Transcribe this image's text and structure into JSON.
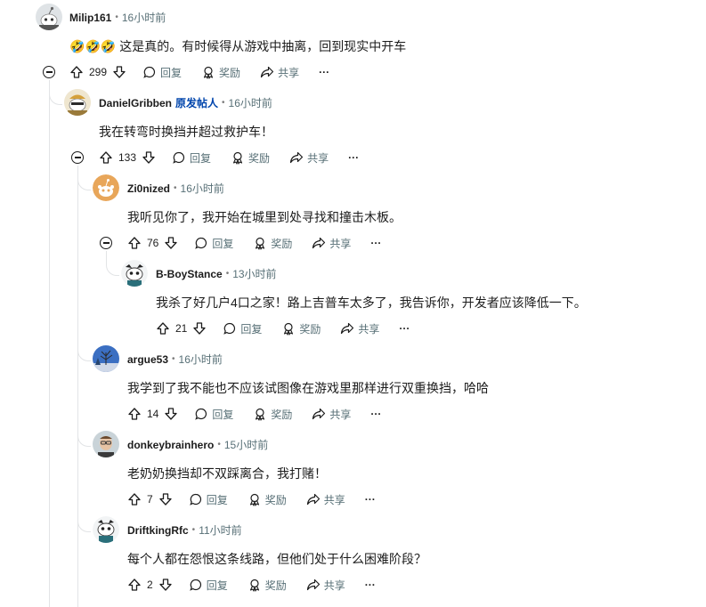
{
  "comments": [
    {
      "username": "Milip161",
      "op_badge": "",
      "time": "16小时前",
      "emoji": [
        "🤣",
        "🤣",
        "🤣"
      ],
      "text": "这是真的。有时候得从游戏中抽离，回到现实中开车",
      "votes": "299",
      "reply": "回复",
      "award": "奖励",
      "share": "共享",
      "more": "···"
    },
    {
      "username": "DanielGribben",
      "op_badge": "原发帖人",
      "time": "16小时前",
      "text": "我在转弯时换挡并超过救护车！",
      "votes": "133",
      "reply": "回复",
      "award": "奖励",
      "share": "共享",
      "more": "···"
    },
    {
      "username": "Zi0nized",
      "time": "16小时前",
      "text": "我听见你了，我开始在城里到处寻找和撞击木板。",
      "votes": "76",
      "reply": "回复",
      "award": "奖励",
      "share": "共享",
      "more": "···"
    },
    {
      "username": "B-BoyStance",
      "time": "13小时前",
      "text": "我杀了好几户4口之家！路上吉普车太多了，我告诉你，开发者应该降低一下。",
      "votes": "21",
      "reply": "回复",
      "award": "奖励",
      "share": "共享",
      "more": "···"
    },
    {
      "username": "argue53",
      "time": "16小时前",
      "text": "我学到了我不能也不应该试图像在游戏里那样进行双重换挡，哈哈",
      "votes": "14",
      "reply": "回复",
      "award": "奖励",
      "share": "共享",
      "more": "···"
    },
    {
      "username": "donkeybrainhero",
      "time": "15小时前",
      "text": "老奶奶换挡却不双踩离合，我打赌！",
      "votes": "7",
      "reply": "回复",
      "award": "奖励",
      "share": "共享",
      "more": "···"
    },
    {
      "username": "DriftkingRfc",
      "time": "11小时前",
      "text": "每个人都在怨恨这条线路，但他们处于什么困难阶段？",
      "votes": "2",
      "reply": "回复",
      "award": "奖励",
      "share": "共享",
      "more": "···"
    }
  ],
  "icons": {
    "upvote": "upvote-icon",
    "downvote": "downvote-icon",
    "reply": "comment-bubble-icon",
    "award": "award-icon",
    "share": "share-arrow-icon",
    "more": "more-dots-icon",
    "collapse": "collapse-minus-icon"
  },
  "colors": {
    "op_badge": "#0045ac",
    "meta_text": "#576f76",
    "thread_line": "#e2e4e6"
  }
}
